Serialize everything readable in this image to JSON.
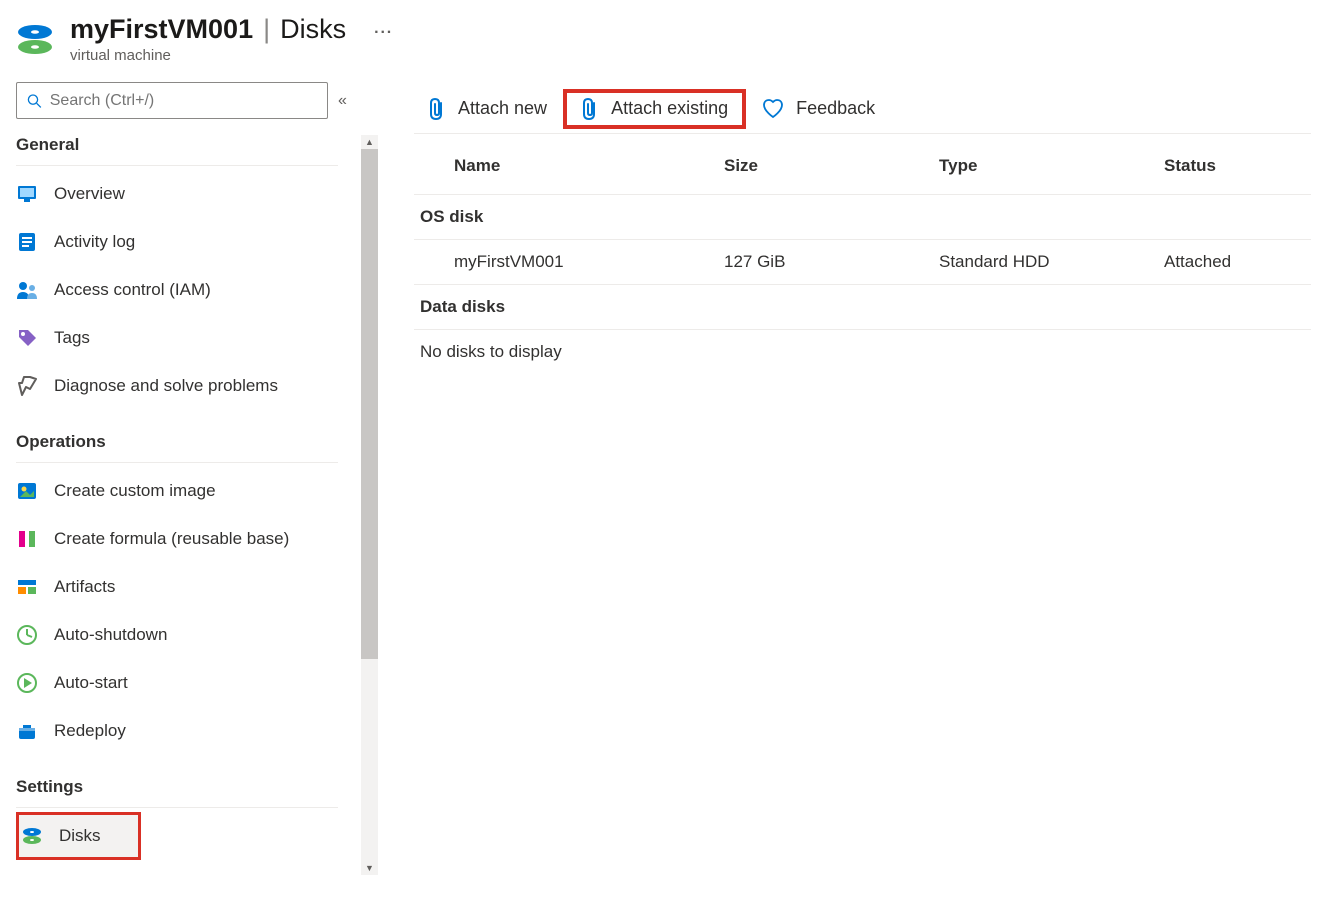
{
  "header": {
    "resource_name": "myFirstVM001",
    "section": "Disks",
    "subtitle": "virtual machine"
  },
  "search": {
    "placeholder": "Search (Ctrl+/)"
  },
  "sidebar": {
    "groups": [
      {
        "title": "General",
        "items": [
          {
            "label": "Overview",
            "icon": "overview"
          },
          {
            "label": "Activity log",
            "icon": "activity-log"
          },
          {
            "label": "Access control (IAM)",
            "icon": "access-control"
          },
          {
            "label": "Tags",
            "icon": "tags"
          },
          {
            "label": "Diagnose and solve problems",
            "icon": "diagnose"
          }
        ]
      },
      {
        "title": "Operations",
        "items": [
          {
            "label": "Create custom image",
            "icon": "custom-image"
          },
          {
            "label": "Create formula (reusable base)",
            "icon": "formula"
          },
          {
            "label": "Artifacts",
            "icon": "artifacts"
          },
          {
            "label": "Auto-shutdown",
            "icon": "auto-shutdown"
          },
          {
            "label": "Auto-start",
            "icon": "auto-start"
          },
          {
            "label": "Redeploy",
            "icon": "redeploy"
          }
        ]
      },
      {
        "title": "Settings",
        "items": [
          {
            "label": "Disks",
            "icon": "disks",
            "active": true
          }
        ]
      }
    ]
  },
  "toolbar": {
    "attach_new": "Attach new",
    "attach_existing": "Attach existing",
    "feedback": "Feedback"
  },
  "table": {
    "headers": {
      "name": "Name",
      "size": "Size",
      "type": "Type",
      "status": "Status"
    },
    "os_section": "OS disk",
    "os_disk": {
      "name": "myFirstVM001",
      "size": "127 GiB",
      "type": "Standard HDD",
      "status": "Attached"
    },
    "data_section": "Data disks",
    "empty": "No disks to display"
  }
}
